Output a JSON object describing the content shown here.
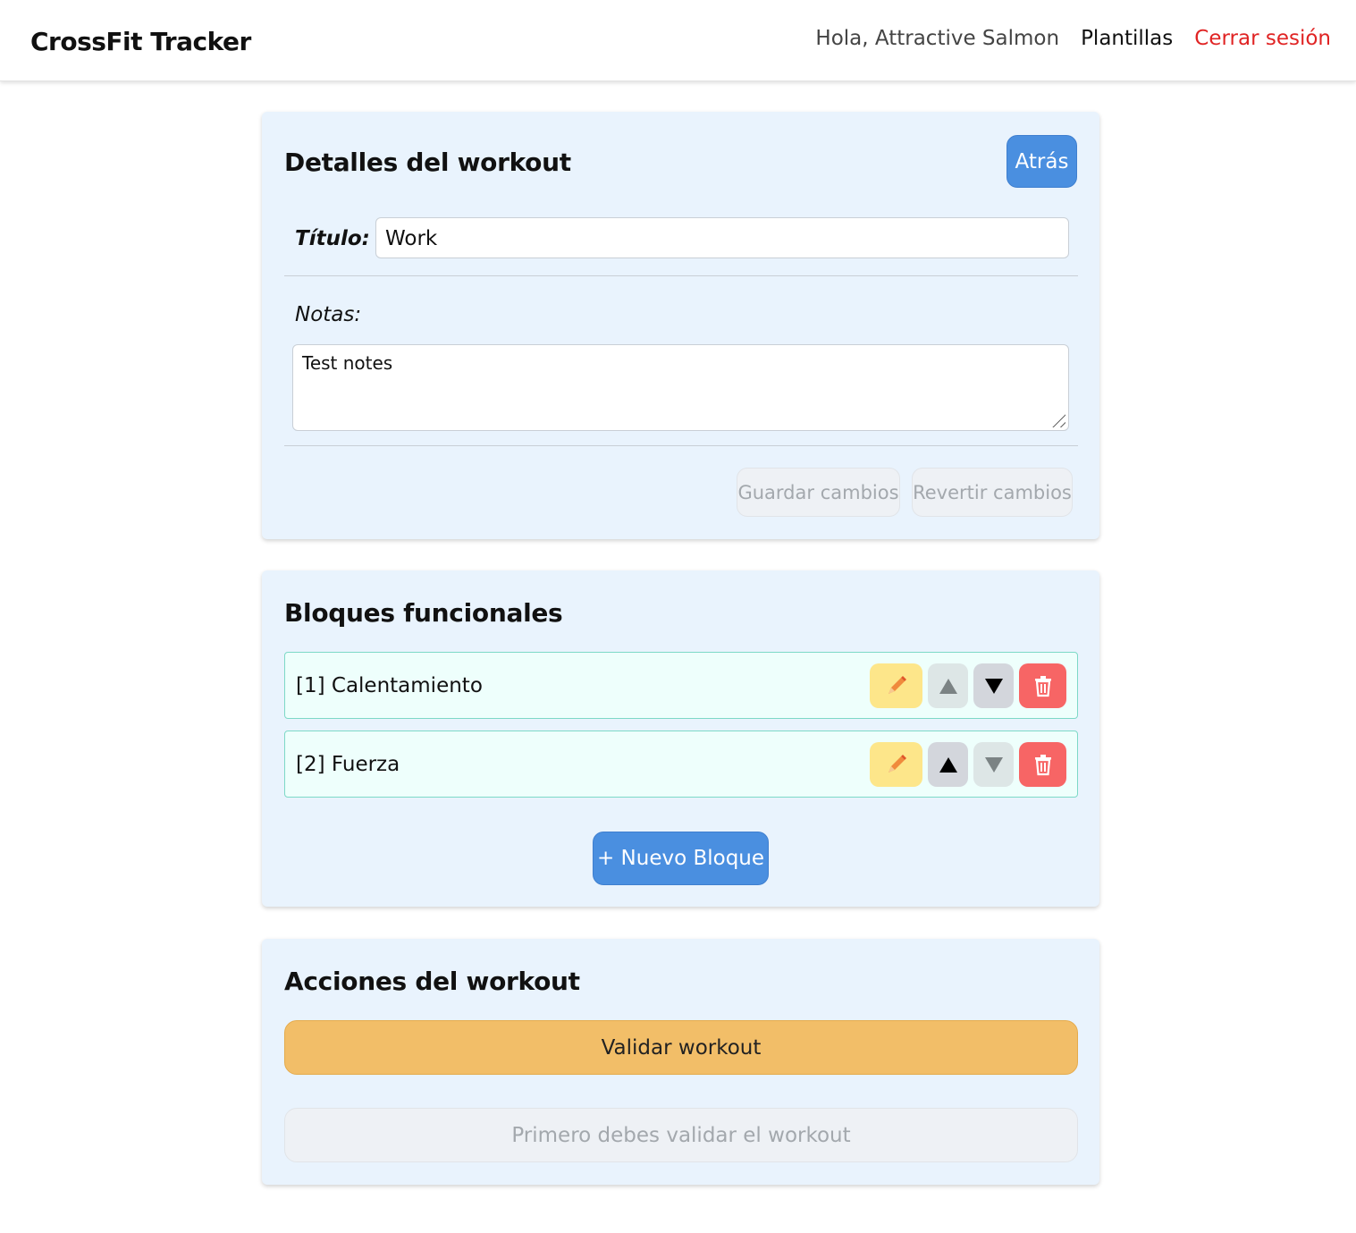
{
  "navbar": {
    "brand": "CrossFit Tracker",
    "greeting": "Hola, Attractive Salmon",
    "templates_link": "Plantillas",
    "logout_link": "Cerrar sesión"
  },
  "details": {
    "title": "Detalles del workout",
    "back_button": "Atrás",
    "title_label": "Título:",
    "title_value": "Work",
    "notes_label": "Notas:",
    "notes_value": "Test notes",
    "save_button": "Guardar cambios",
    "revert_button": "Revertir cambios"
  },
  "blocks": {
    "title": "Bloques funcionales",
    "items": [
      {
        "label": "[1] Calentamiento",
        "up_enabled": false,
        "down_enabled": true
      },
      {
        "label": "[2] Fuerza",
        "up_enabled": true,
        "down_enabled": false
      }
    ],
    "new_button": "+ Nuevo Bloque"
  },
  "actions": {
    "title": "Acciones del workout",
    "validate_button": "Validar workout",
    "finish_button_disabled": "Primero debes validar el workout"
  },
  "icons": {
    "edit": "pencil-icon",
    "up": "arrow-up-icon",
    "down": "arrow-down-icon",
    "delete": "trash-icon"
  },
  "colors": {
    "primary": "#4a8fe0",
    "danger": "#e02424",
    "card_bg": "#e9f3fd",
    "block_bg": "#eefffc",
    "block_border": "#7dd9c7",
    "edit_bg": "#fde68a",
    "delete_bg": "#f76565",
    "validate_bg": "#f2be68"
  }
}
